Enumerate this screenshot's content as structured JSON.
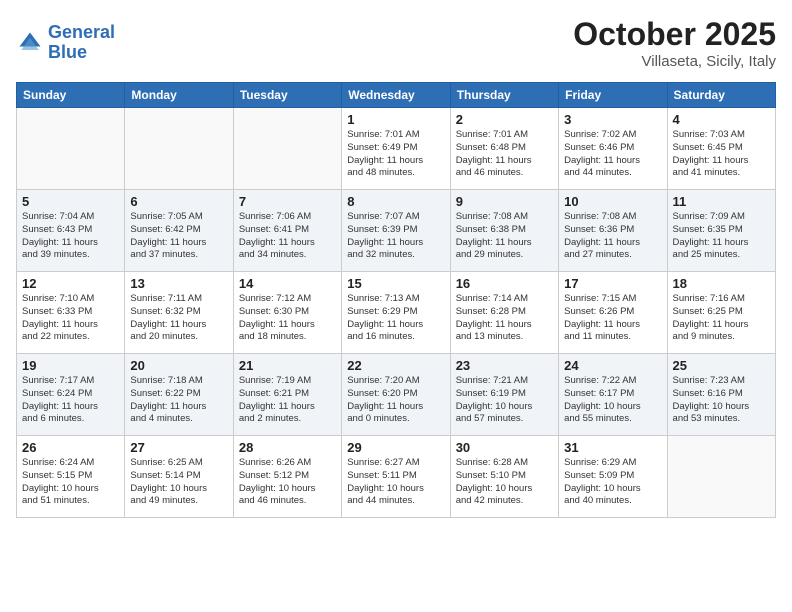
{
  "header": {
    "logo_line1": "General",
    "logo_line2": "Blue",
    "month_year": "October 2025",
    "location": "Villaseta, Sicily, Italy"
  },
  "weekdays": [
    "Sunday",
    "Monday",
    "Tuesday",
    "Wednesday",
    "Thursday",
    "Friday",
    "Saturday"
  ],
  "weeks": [
    [
      {
        "day": "",
        "info": ""
      },
      {
        "day": "",
        "info": ""
      },
      {
        "day": "",
        "info": ""
      },
      {
        "day": "1",
        "info": "Sunrise: 7:01 AM\nSunset: 6:49 PM\nDaylight: 11 hours\nand 48 minutes."
      },
      {
        "day": "2",
        "info": "Sunrise: 7:01 AM\nSunset: 6:48 PM\nDaylight: 11 hours\nand 46 minutes."
      },
      {
        "day": "3",
        "info": "Sunrise: 7:02 AM\nSunset: 6:46 PM\nDaylight: 11 hours\nand 44 minutes."
      },
      {
        "day": "4",
        "info": "Sunrise: 7:03 AM\nSunset: 6:45 PM\nDaylight: 11 hours\nand 41 minutes."
      }
    ],
    [
      {
        "day": "5",
        "info": "Sunrise: 7:04 AM\nSunset: 6:43 PM\nDaylight: 11 hours\nand 39 minutes."
      },
      {
        "day": "6",
        "info": "Sunrise: 7:05 AM\nSunset: 6:42 PM\nDaylight: 11 hours\nand 37 minutes."
      },
      {
        "day": "7",
        "info": "Sunrise: 7:06 AM\nSunset: 6:41 PM\nDaylight: 11 hours\nand 34 minutes."
      },
      {
        "day": "8",
        "info": "Sunrise: 7:07 AM\nSunset: 6:39 PM\nDaylight: 11 hours\nand 32 minutes."
      },
      {
        "day": "9",
        "info": "Sunrise: 7:08 AM\nSunset: 6:38 PM\nDaylight: 11 hours\nand 29 minutes."
      },
      {
        "day": "10",
        "info": "Sunrise: 7:08 AM\nSunset: 6:36 PM\nDaylight: 11 hours\nand 27 minutes."
      },
      {
        "day": "11",
        "info": "Sunrise: 7:09 AM\nSunset: 6:35 PM\nDaylight: 11 hours\nand 25 minutes."
      }
    ],
    [
      {
        "day": "12",
        "info": "Sunrise: 7:10 AM\nSunset: 6:33 PM\nDaylight: 11 hours\nand 22 minutes."
      },
      {
        "day": "13",
        "info": "Sunrise: 7:11 AM\nSunset: 6:32 PM\nDaylight: 11 hours\nand 20 minutes."
      },
      {
        "day": "14",
        "info": "Sunrise: 7:12 AM\nSunset: 6:30 PM\nDaylight: 11 hours\nand 18 minutes."
      },
      {
        "day": "15",
        "info": "Sunrise: 7:13 AM\nSunset: 6:29 PM\nDaylight: 11 hours\nand 16 minutes."
      },
      {
        "day": "16",
        "info": "Sunrise: 7:14 AM\nSunset: 6:28 PM\nDaylight: 11 hours\nand 13 minutes."
      },
      {
        "day": "17",
        "info": "Sunrise: 7:15 AM\nSunset: 6:26 PM\nDaylight: 11 hours\nand 11 minutes."
      },
      {
        "day": "18",
        "info": "Sunrise: 7:16 AM\nSunset: 6:25 PM\nDaylight: 11 hours\nand 9 minutes."
      }
    ],
    [
      {
        "day": "19",
        "info": "Sunrise: 7:17 AM\nSunset: 6:24 PM\nDaylight: 11 hours\nand 6 minutes."
      },
      {
        "day": "20",
        "info": "Sunrise: 7:18 AM\nSunset: 6:22 PM\nDaylight: 11 hours\nand 4 minutes."
      },
      {
        "day": "21",
        "info": "Sunrise: 7:19 AM\nSunset: 6:21 PM\nDaylight: 11 hours\nand 2 minutes."
      },
      {
        "day": "22",
        "info": "Sunrise: 7:20 AM\nSunset: 6:20 PM\nDaylight: 11 hours\nand 0 minutes."
      },
      {
        "day": "23",
        "info": "Sunrise: 7:21 AM\nSunset: 6:19 PM\nDaylight: 10 hours\nand 57 minutes."
      },
      {
        "day": "24",
        "info": "Sunrise: 7:22 AM\nSunset: 6:17 PM\nDaylight: 10 hours\nand 55 minutes."
      },
      {
        "day": "25",
        "info": "Sunrise: 7:23 AM\nSunset: 6:16 PM\nDaylight: 10 hours\nand 53 minutes."
      }
    ],
    [
      {
        "day": "26",
        "info": "Sunrise: 6:24 AM\nSunset: 5:15 PM\nDaylight: 10 hours\nand 51 minutes."
      },
      {
        "day": "27",
        "info": "Sunrise: 6:25 AM\nSunset: 5:14 PM\nDaylight: 10 hours\nand 49 minutes."
      },
      {
        "day": "28",
        "info": "Sunrise: 6:26 AM\nSunset: 5:12 PM\nDaylight: 10 hours\nand 46 minutes."
      },
      {
        "day": "29",
        "info": "Sunrise: 6:27 AM\nSunset: 5:11 PM\nDaylight: 10 hours\nand 44 minutes."
      },
      {
        "day": "30",
        "info": "Sunrise: 6:28 AM\nSunset: 5:10 PM\nDaylight: 10 hours\nand 42 minutes."
      },
      {
        "day": "31",
        "info": "Sunrise: 6:29 AM\nSunset: 5:09 PM\nDaylight: 10 hours\nand 40 minutes."
      },
      {
        "day": "",
        "info": ""
      }
    ]
  ]
}
